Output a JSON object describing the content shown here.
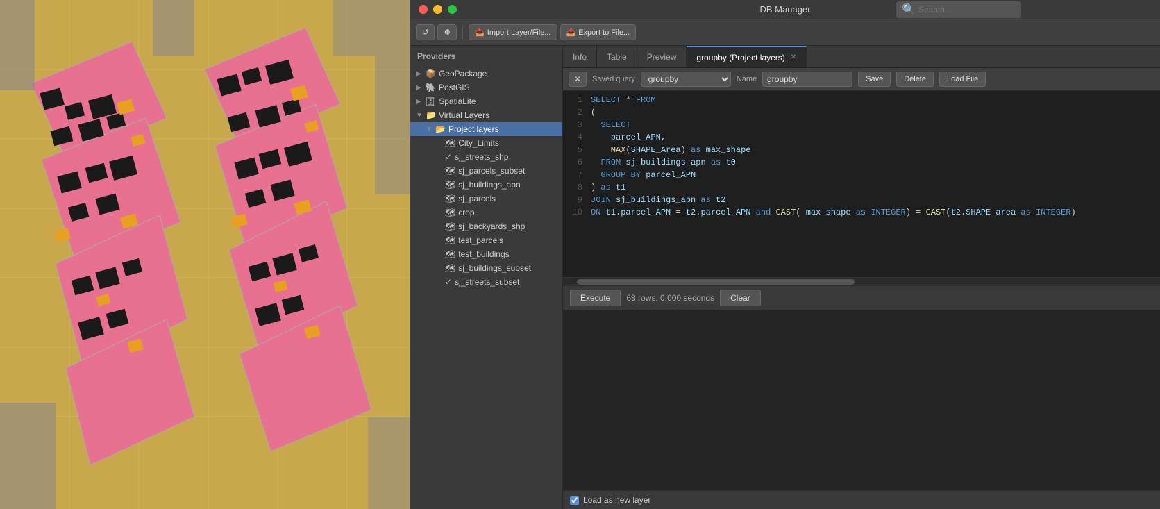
{
  "window": {
    "title": "DB Manager",
    "search_placeholder": "Search..."
  },
  "toolbar": {
    "refresh_label": "↺",
    "import_label": "Import Layer/File...",
    "export_label": "Export to File..."
  },
  "sidebar": {
    "providers_label": "Providers",
    "items": [
      {
        "id": "geopackage",
        "label": "GeoPackage",
        "indent": 1,
        "arrow": "▶",
        "icon": "📦",
        "expandable": true
      },
      {
        "id": "postgis",
        "label": "PostGIS",
        "indent": 1,
        "arrow": "▶",
        "icon": "🐘",
        "expandable": true
      },
      {
        "id": "spatialite",
        "label": "SpatiaLite",
        "indent": 1,
        "arrow": "▶",
        "icon": "🗄",
        "expandable": true
      },
      {
        "id": "virtual-layers",
        "label": "Virtual Layers",
        "indent": 1,
        "arrow": "▼",
        "icon": "📁",
        "expandable": true
      },
      {
        "id": "project-layers",
        "label": "Project layers",
        "indent": 2,
        "arrow": "▼",
        "icon": "📂",
        "expandable": true,
        "selected": true
      },
      {
        "id": "city-limits",
        "label": "City_Limits",
        "indent": 3,
        "arrow": "",
        "icon": "🗺"
      },
      {
        "id": "sj-streets-shp",
        "label": "sj_streets_shp",
        "indent": 3,
        "arrow": "",
        "icon": "✓"
      },
      {
        "id": "sj-parcels-subset",
        "label": "sj_parcels_subset",
        "indent": 3,
        "arrow": "",
        "icon": "🗺"
      },
      {
        "id": "sj-buildings-apn",
        "label": "sj_buildings_apn",
        "indent": 3,
        "arrow": "",
        "icon": "🗺"
      },
      {
        "id": "sj-parcels",
        "label": "sj_parcels",
        "indent": 3,
        "arrow": "",
        "icon": "🗺"
      },
      {
        "id": "crop",
        "label": "crop",
        "indent": 3,
        "arrow": "",
        "icon": "🗺"
      },
      {
        "id": "sj-backyards-shp",
        "label": "sj_backyards_shp",
        "indent": 3,
        "arrow": "",
        "icon": "🗺"
      },
      {
        "id": "test-parcels",
        "label": "test_parcels",
        "indent": 3,
        "arrow": "",
        "icon": "🗺"
      },
      {
        "id": "test-buildings",
        "label": "test_buildings",
        "indent": 3,
        "arrow": "",
        "icon": "🗺"
      },
      {
        "id": "sj-buildings-subset",
        "label": "sj_buildings_subset",
        "indent": 3,
        "arrow": "",
        "icon": "🗺"
      },
      {
        "id": "sj-streets-subset",
        "label": "sj_streets_subset",
        "indent": 3,
        "arrow": "",
        "icon": "✓"
      }
    ]
  },
  "tabs": [
    {
      "id": "info",
      "label": "Info",
      "active": false,
      "closable": false
    },
    {
      "id": "table",
      "label": "Table",
      "active": false,
      "closable": false
    },
    {
      "id": "preview",
      "label": "Preview",
      "active": false,
      "closable": false
    },
    {
      "id": "groupby",
      "label": "groupby (Project layers)",
      "active": true,
      "closable": true
    }
  ],
  "query_toolbar": {
    "saved_query_label": "Saved query",
    "saved_query_value": "groupby",
    "name_label": "Name",
    "name_value": "groupby",
    "save_label": "Save",
    "delete_label": "Delete",
    "load_file_label": "Load File"
  },
  "sql": {
    "lines": [
      {
        "num": 1,
        "tokens": [
          {
            "t": "kw",
            "v": "SELECT"
          },
          {
            "t": "op",
            "v": " * "
          },
          {
            "t": "kw",
            "v": "FROM"
          }
        ]
      },
      {
        "num": 2,
        "tokens": [
          {
            "t": "op",
            "v": "("
          }
        ]
      },
      {
        "num": 3,
        "tokens": [
          {
            "t": "kw",
            "v": "  SELECT"
          }
        ]
      },
      {
        "num": 4,
        "tokens": [
          {
            "t": "id",
            "v": "    parcel_APN,"
          }
        ]
      },
      {
        "num": 5,
        "tokens": [
          {
            "t": "fn",
            "v": "    MAX"
          },
          {
            "t": "op",
            "v": "("
          },
          {
            "t": "id",
            "v": "SHAPE_Area"
          },
          {
            "t": "op",
            "v": ") "
          },
          {
            "t": "kw",
            "v": "as"
          },
          {
            "t": "id",
            "v": " max_shape"
          }
        ]
      },
      {
        "num": 6,
        "tokens": [
          {
            "t": "kw",
            "v": "  FROM"
          },
          {
            "t": "id",
            "v": " sj_buildings_apn"
          },
          {
            "t": "kw",
            "v": " as"
          },
          {
            "t": "id",
            "v": " t0"
          }
        ]
      },
      {
        "num": 7,
        "tokens": [
          {
            "t": "kw",
            "v": "  GROUP BY"
          },
          {
            "t": "id",
            "v": " parcel_APN"
          }
        ]
      },
      {
        "num": 8,
        "tokens": [
          {
            "t": "op",
            "v": ") "
          },
          {
            "t": "kw",
            "v": "as"
          },
          {
            "t": "id",
            "v": " t1"
          }
        ]
      },
      {
        "num": 9,
        "tokens": [
          {
            "t": "kw",
            "v": "JOIN"
          },
          {
            "t": "id",
            "v": " sj_buildings_apn"
          },
          {
            "t": "kw",
            "v": " as"
          },
          {
            "t": "id",
            "v": " t2"
          }
        ]
      },
      {
        "num": 10,
        "tokens": [
          {
            "t": "kw",
            "v": "ON"
          },
          {
            "t": "id",
            "v": " t1.parcel_APN"
          },
          {
            "t": "op",
            "v": " = "
          },
          {
            "t": "id",
            "v": "t2.parcel_APN"
          },
          {
            "t": "kw",
            "v": " and "
          },
          {
            "t": "fn",
            "v": "CAST"
          },
          {
            "t": "op",
            "v": "( "
          },
          {
            "t": "id",
            "v": "max_shape"
          },
          {
            "t": "kw",
            "v": " as "
          },
          {
            "t": "kw",
            "v": "INTEGER"
          },
          {
            "t": "op",
            "v": ") = "
          },
          {
            "t": "fn",
            "v": "CAST"
          },
          {
            "t": "op",
            "v": "("
          },
          {
            "t": "id",
            "v": "t2.SHAPE_area"
          },
          {
            "t": "kw",
            "v": " as "
          },
          {
            "t": "kw",
            "v": "INTEGER"
          },
          {
            "t": "op",
            "v": ")"
          }
        ]
      }
    ]
  },
  "action_bar": {
    "execute_label": "Execute",
    "status_text": "68 rows, 0.000 seconds",
    "clear_label": "Clear"
  },
  "load_layer": {
    "label": "Load as new layer",
    "checked": true
  }
}
